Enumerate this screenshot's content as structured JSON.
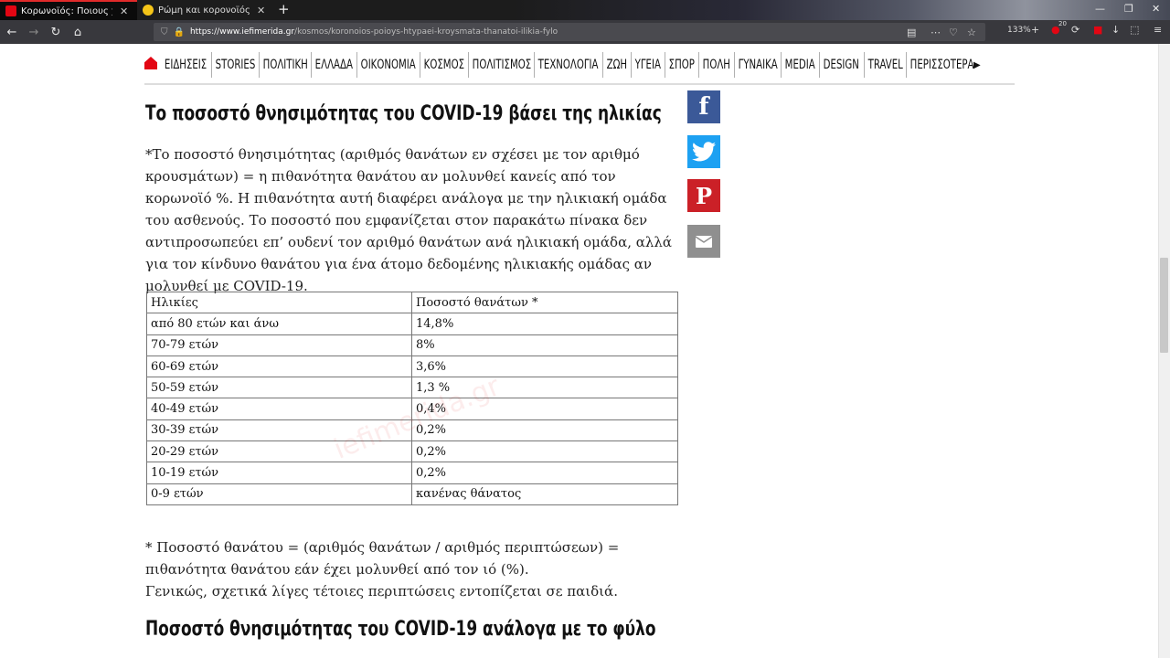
{
  "browser": {
    "tabs": [
      {
        "title": "Κορωνοϊός: Ποιους χτυπάει",
        "favicon_color": "#e30613",
        "active": true
      },
      {
        "title": "Ρώμη και κορονοϊός - Σελίδα",
        "favicon_color": "#f5c518",
        "active": false
      }
    ],
    "url_domain": "https://www.iefimerida.gr",
    "url_path": "/kosmos/koronoios-poioys-htypaei-kroysmata-thanatoi-ilikia-fylo",
    "zoom": "133%",
    "badge_count": "20"
  },
  "site_menu": [
    "ΕΙΔΗΣΕΙΣ",
    "STORIES",
    "ΠΟΛΙΤΙΚΗ",
    "ΕΛΛΑΔΑ",
    "ΟΙΚΟΝΟΜΙΑ",
    "ΚΟΣΜΟΣ",
    "ΠΟΛΙΤΙΣΜΟΣ",
    "ΤΕΧΝΟΛΟΓΙΑ",
    "ΖΩΗ",
    "ΥΓΕΙΑ",
    "ΣΠΟΡ",
    "ΠΟΛΗ",
    "ΓΥΝΑΙΚΑ",
    "MEDIA",
    "DESIGN",
    "TRAVEL",
    "ΠΕΡΙΣΣΟΤΕΡΑ"
  ],
  "article": {
    "heading": "Το ποσοστό θνησιμότητας του COVID-19 βάσει της ηλικίας",
    "intro": "*Το ποσοστό θνησιμότητας (αριθμός θανάτων εν σχέσει με τον αριθμό κρουσμάτων) = η πιθανότητα θανάτου αν μολυνθεί κανείς από τον κορωνοϊό %. Η πιθανότητα αυτή διαφέρει ανάλογα με την ηλικιακή ομάδα του ασθενούς. Το ποσοστό που εμφανίζεται στον παρακάτω πίνακα δεν αντιπροσωπεύει επ’ ουδενί τον αριθμό θανάτων ανά ηλικιακή ομάδα, αλλά για τον κίνδυνο θανάτου για ένα άτομο δεδομένης ηλικιακής ομάδας αν μολυνθεί με COVID-19.",
    "table": {
      "headers": [
        "Ηλικίες",
        "Ποσοστό θανάτων *"
      ],
      "rows": [
        [
          "από 80 ετών και άνω",
          "14,8%"
        ],
        [
          "70-79 ετών",
          "8%"
        ],
        [
          "60-69 ετών",
          "3,6%"
        ],
        [
          "50-59 ετών",
          "1,3 %"
        ],
        [
          "40-49 ετών",
          "0,4%"
        ],
        [
          "30-39 ετών",
          "0,2%"
        ],
        [
          "20-29 ετών",
          "0,2%"
        ],
        [
          "10-19 ετών",
          "0,2%"
        ],
        [
          "0-9 ετών",
          "κανένας θάνατος"
        ]
      ],
      "watermark": "iefimerida.gr"
    },
    "footnote_1": "* Ποσοστό θανάτου = (αριθμός θανάτων / αριθμός περιπτώσεων) = πιθανότητα θανάτου εάν έχει μολυνθεί από τον ιό (%).",
    "footnote_2": "Γενικώς, σχετικά λίγες τέτοιες περιπτώσεις εντοπίζεται σε παιδιά.",
    "heading_2": "Ποσοστό θνησιμότητας του COVID-19 ανάλογα με το φύλο"
  },
  "share": {
    "facebook": "f",
    "pinterest": "P"
  }
}
